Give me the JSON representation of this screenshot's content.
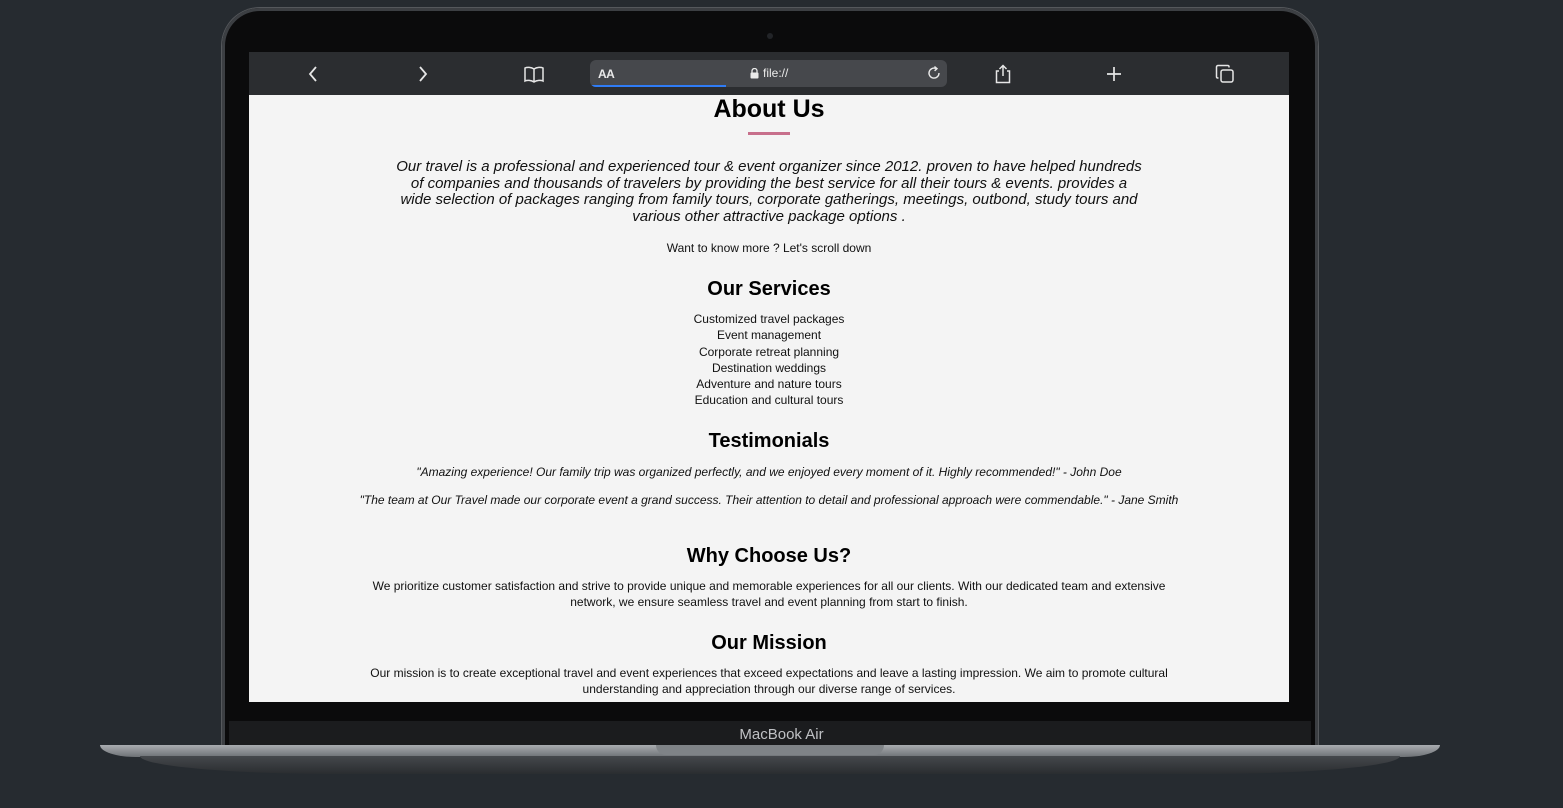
{
  "device": {
    "brand_label": "MacBook Air"
  },
  "browser": {
    "text_size_label": "AA",
    "url": "file://",
    "load_progress_pct": 38,
    "icons": [
      "back-icon",
      "forward-icon",
      "bookmarks-icon",
      "lock-icon",
      "reload-icon",
      "share-icon",
      "new-tab-icon",
      "tabs-icon"
    ]
  },
  "about": {
    "title": "About Us",
    "intro": "Our travel is a professional and experienced tour & event organizer since 2012. proven to have helped hundreds of companies and thousands of travelers by providing the best service for all their tours & events. provides a wide selection of packages ranging from family tours, corporate gatherings, meetings, outbond, study tours and various other attractive package options .",
    "scroll_hint": "Want to know more ? Let's scroll down",
    "accent_color": "#c76f8b"
  },
  "services": {
    "title": "Our Services",
    "items": [
      "Customized travel packages",
      "Event management",
      "Corporate retreat planning",
      "Destination weddings",
      "Adventure and nature tours",
      "Education and cultural tours"
    ]
  },
  "testimonials": {
    "title": "Testimonials",
    "quotes": [
      "\"Amazing experience! Our family trip was organized perfectly, and we enjoyed every moment of it. Highly recommended!\" - John Doe",
      "\"The team at Our Travel made our corporate event a grand success. Their attention to detail and professional approach were commendable.\" - Jane Smith"
    ]
  },
  "why": {
    "title": "Why Choose Us?",
    "text": "We prioritize customer satisfaction and strive to provide unique and memorable experiences for all our clients. With our dedicated team and extensive network, we ensure seamless travel and event planning from start to finish."
  },
  "mission": {
    "title": "Our Mission",
    "text": "Our mission is to create exceptional travel and event experiences that exceed expectations and leave a lasting impression. We aim to promote cultural understanding and appreciation through our diverse range of services."
  }
}
